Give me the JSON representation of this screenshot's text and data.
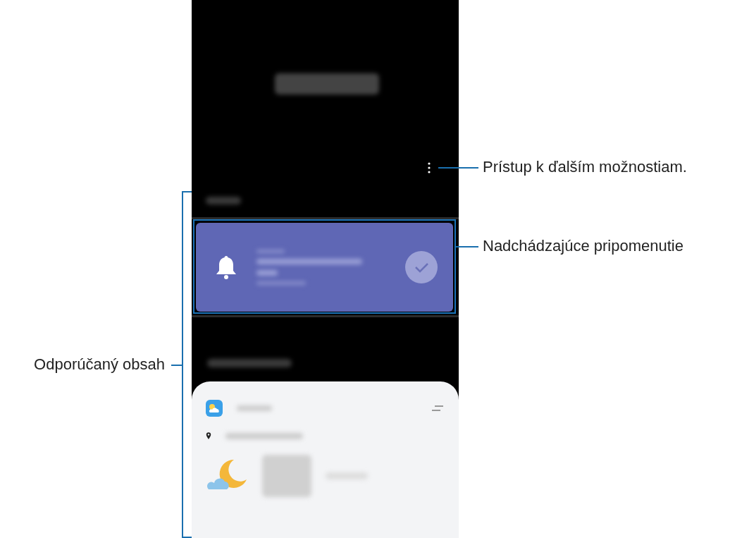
{
  "callouts": [
    {
      "text": "Prístup k ďalším možnostiam."
    },
    {
      "text": "Nadchádzajúce pripomenutie"
    }
  ],
  "bracket": {
    "label": "Odporúčaný obsah"
  }
}
